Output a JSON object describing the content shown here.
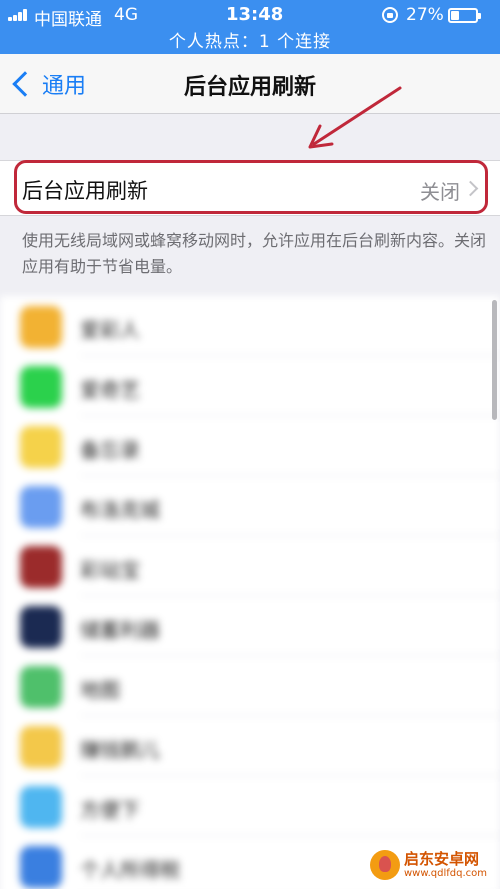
{
  "status_bar": {
    "carrier": "中国联通",
    "network": "4G",
    "time": "13:48",
    "battery": "27%",
    "hotspot": "个人热点：1 个连接",
    "background_color": "#3b8ff0"
  },
  "nav": {
    "back_label": "通用",
    "title": "后台应用刷新"
  },
  "setting": {
    "label": "后台应用刷新",
    "value": "关闭",
    "highlight_color": "#c0283a"
  },
  "footer_note": "使用无线局域网或蜂窝移动网时，允许应用在后台刷新内容。关闭应用有助于节省电量。",
  "apps": [
    {
      "name": "爱彩人",
      "color": "#f2b233"
    },
    {
      "name": "爱奇艺",
      "color": "#2bd14c"
    },
    {
      "name": "备忘录",
      "color": "#f5d24a"
    },
    {
      "name": "布洛克城",
      "color": "#6a9df0"
    },
    {
      "name": "彩站宝",
      "color": "#9b2b2b"
    },
    {
      "name": "储蓄利器",
      "color": "#1b2a52"
    },
    {
      "name": "地图",
      "color": "#4fc06b"
    },
    {
      "name": "赚钱鹅儿",
      "color": "#f3c84a"
    },
    {
      "name": "方便下",
      "color": "#4fb6f0"
    },
    {
      "name": "个人所得税",
      "color": "#3a7fe0"
    }
  ],
  "watermark": {
    "name": "启东安卓网",
    "url": "www.qdlfdq.com"
  }
}
